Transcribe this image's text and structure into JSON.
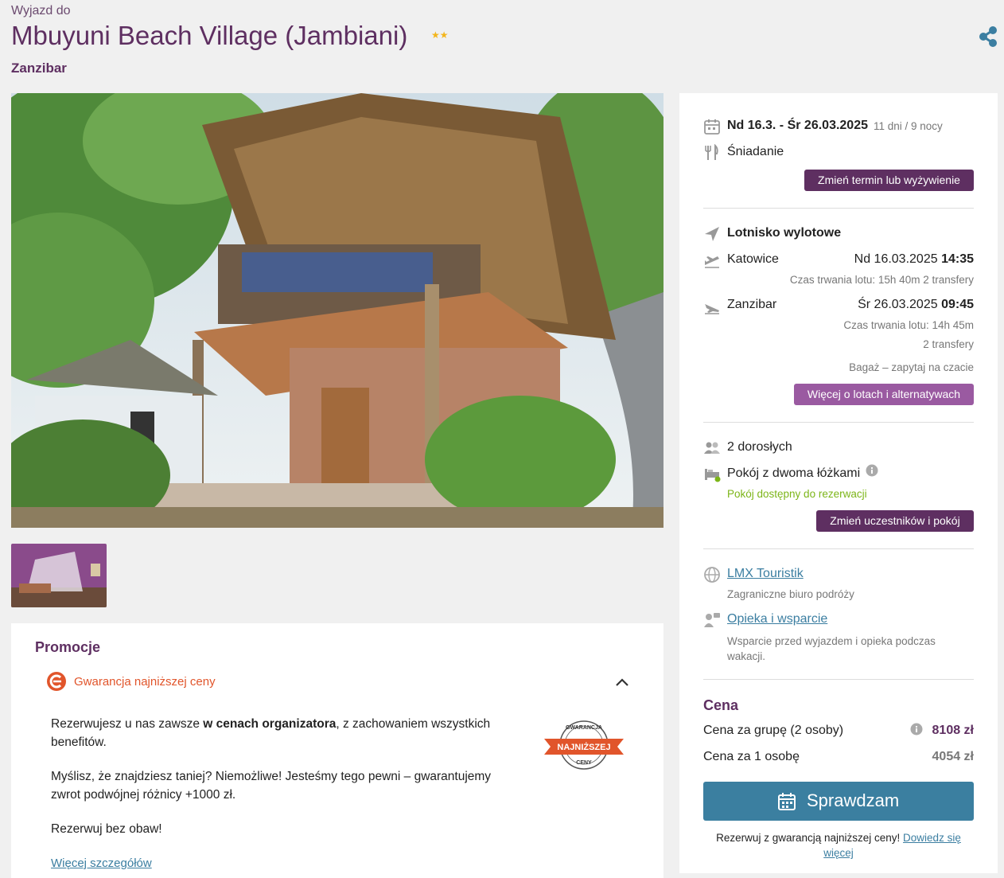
{
  "header": {
    "pretitle": "Wyjazd do",
    "title": "Mbuyuni Beach Village (Jambiani)",
    "stars": "★★",
    "region": "Zanzibar"
  },
  "colors": {
    "brand": "#5e2f61",
    "accent_orange": "#e1552b",
    "link": "#3b7ea1",
    "cta": "#3b7fa0",
    "available": "#7cb518"
  },
  "icons": [
    "share-icon",
    "calendar-icon",
    "cutlery-icon",
    "plane-icon",
    "plane-takeoff-icon",
    "plane-landing-icon",
    "people-icon",
    "bed-icon",
    "info-icon",
    "globe-icon",
    "support-icon",
    "chevron-up-icon"
  ],
  "promo": {
    "title": "Promocje",
    "item_label": "Gwarancja najniższej ceny",
    "p1_before": "Rezerwujesz u nas zawsze ",
    "p1_bold": "w cenach organizatora",
    "p1_after": ", z zachowaniem wszystkich benefitów.",
    "p2": "Myślisz, że znajdziesz taniej? Niemożliwe! Jesteśmy tego pewni – gwarantujemy zwrot podwójnej różnicy +1000 zł.",
    "p3": "Rezerwuj bez obaw!",
    "more_link": "Więcej szczegółów",
    "badge_top": "GWARANCJA",
    "badge_mid": "NAJNIŻSZEJ",
    "badge_bottom": "CENY"
  },
  "sidebar": {
    "dates": "Nd 16.3. - Śr 26.03.2025",
    "duration": "11 dni / 9 nocy",
    "board": "Śniadanie",
    "change_term_button": "Zmień termin lub wyżywienie",
    "airport_label": "Lotnisko wylotowe",
    "outbound": {
      "city": "Katowice",
      "date": "Nd 16.03.2025",
      "time": "14:35",
      "duration": "Czas trwania lotu: 15h 40m",
      "transfers": "2 transfery"
    },
    "inbound": {
      "city": "Zanzibar",
      "date": "Śr 26.03.2025",
      "time": "09:45",
      "duration": "Czas trwania lotu: 14h 45m",
      "transfers": "2 transfery"
    },
    "baggage": "Bagaż – zapytaj na czacie",
    "flights_button": "Więcej o lotach i alternatywach",
    "travellers": "2 dorosłych",
    "room": "Pokój z dwoma łóżkami",
    "room_status": "Pokój dostępny do rezerwacji",
    "change_people_button": "Zmień uczestników i pokój",
    "operator_link": "LMX Touristik",
    "operator_desc": "Zagraniczne biuro podróży",
    "support_link": "Opieka i wsparcie",
    "support_desc": "Wsparcie przed wyjazdem i opieka podczas wakacji.",
    "price_title": "Cena",
    "group_price_label": "Cena za grupę (2 osoby)",
    "group_price": "8108 zł",
    "person_price_label": "Cena za 1 osobę",
    "person_price": "4054 zł",
    "cta_label": "Sprawdzam",
    "footer_text": "Rezerwuj z gwarancją najniższej ceny!",
    "footer_link": "Dowiedz się więcej"
  }
}
